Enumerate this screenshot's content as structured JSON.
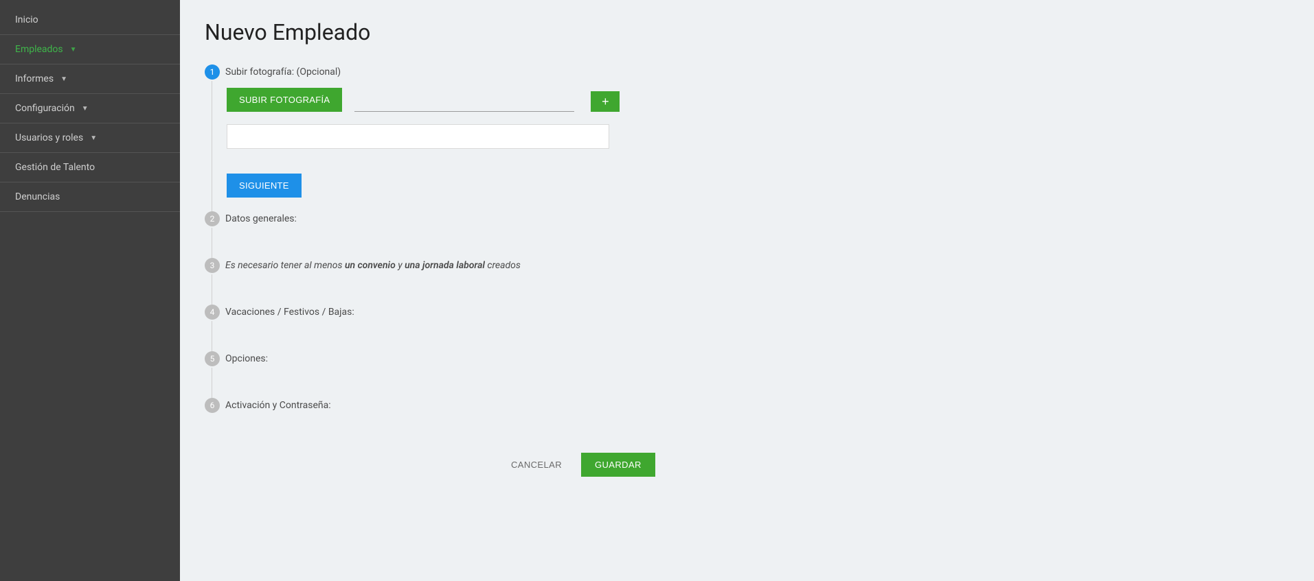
{
  "sidebar": {
    "items": [
      {
        "label": "Inicio",
        "has_caret": false,
        "active": false
      },
      {
        "label": "Empleados",
        "has_caret": true,
        "active": true
      },
      {
        "label": "Informes",
        "has_caret": true,
        "active": false
      },
      {
        "label": "Configuración",
        "has_caret": true,
        "active": false
      },
      {
        "label": "Usuarios y roles",
        "has_caret": true,
        "active": false
      },
      {
        "label": "Gestión de Talento",
        "has_caret": false,
        "active": false
      },
      {
        "label": "Denuncias",
        "has_caret": false,
        "active": false
      }
    ]
  },
  "page": {
    "title": "Nuevo Empleado"
  },
  "steps": [
    {
      "num": "1",
      "label": "Subir fotografía: (Opcional)",
      "active": true,
      "body": {
        "upload_button": "SUBIR FOTOGRAFÍA",
        "plus": "+",
        "next_button": "SIGUIENTE"
      }
    },
    {
      "num": "2",
      "label": "Datos generales:",
      "active": false
    },
    {
      "num": "3",
      "label_parts": {
        "pre": "Es necesario tener al menos ",
        "b1": "un convenio",
        "mid": " y ",
        "b2": "una jornada laboral",
        "post": " creados"
      },
      "italic": true,
      "active": false
    },
    {
      "num": "4",
      "label": "Vacaciones / Festivos / Bajas:",
      "active": false
    },
    {
      "num": "5",
      "label": "Opciones:",
      "active": false
    },
    {
      "num": "6",
      "label": "Activación y Contraseña:",
      "active": false
    }
  ],
  "footer": {
    "cancel": "CANCELAR",
    "save": "GUARDAR"
  }
}
